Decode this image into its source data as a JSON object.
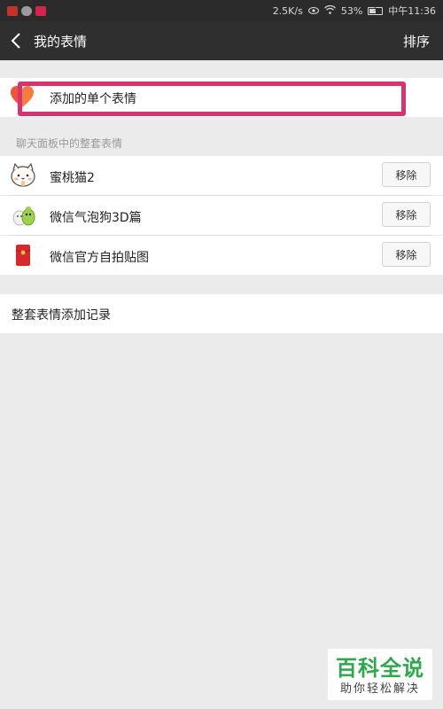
{
  "status_bar": {
    "network_speed": "2.5K/s",
    "battery": "53%",
    "battery_level": 0.53,
    "time": "中午11:36",
    "app_icons": [
      {
        "name": "red-app-icon",
        "color": "#c8302a"
      },
      {
        "name": "wechat-icon",
        "color": "#9a9a9a"
      },
      {
        "name": "promo-app-icon",
        "color": "#d4234f"
      }
    ]
  },
  "header": {
    "title": "我的表情",
    "sort_label": "排序"
  },
  "single_stickers": {
    "label": "添加的单个表情",
    "highlight_color": "#d8336f"
  },
  "packs_section": {
    "label": "聊天面板中的整套表情",
    "items": [
      {
        "name": "蜜桃猫2",
        "button": "移除",
        "icon": "peach-cat-icon"
      },
      {
        "name": "微信气泡狗3D篇",
        "button": "移除",
        "icon": "bubble-dog-icon"
      },
      {
        "name": "微信官方自拍贴图",
        "button": "移除",
        "icon": "red-envelope-icon"
      }
    ]
  },
  "history": {
    "label": "整套表情添加记录"
  },
  "watermark": {
    "title": "百科全说",
    "subtitle": "助你轻松解决"
  }
}
